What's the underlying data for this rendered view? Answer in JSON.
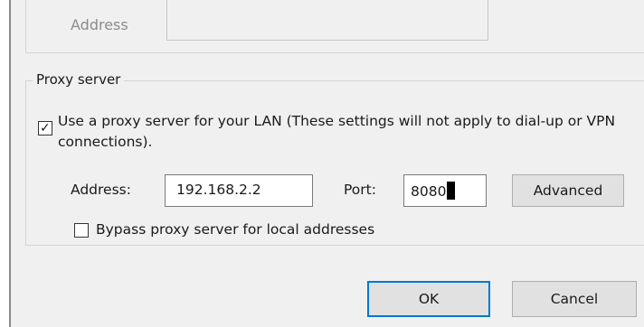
{
  "automatic_config": {
    "address_label": "Address",
    "address_value": ""
  },
  "proxy_server": {
    "group_title": "Proxy server",
    "use_proxy_checked": true,
    "use_proxy_label": "Use a proxy server for your LAN (These settings will not apply to dial-up or VPN connections).",
    "address_label": "Address:",
    "address_value": "192.168.2.2",
    "port_label": "Port:",
    "port_value": "8080",
    "advanced_label": "Advanced",
    "bypass_checked": false,
    "bypass_label": "Bypass proxy server for local addresses"
  },
  "buttons": {
    "ok_label": "OK",
    "cancel_label": "Cancel"
  },
  "colors": {
    "dialog_background": "#f0f0f0",
    "focus_accent": "#0078d7"
  }
}
